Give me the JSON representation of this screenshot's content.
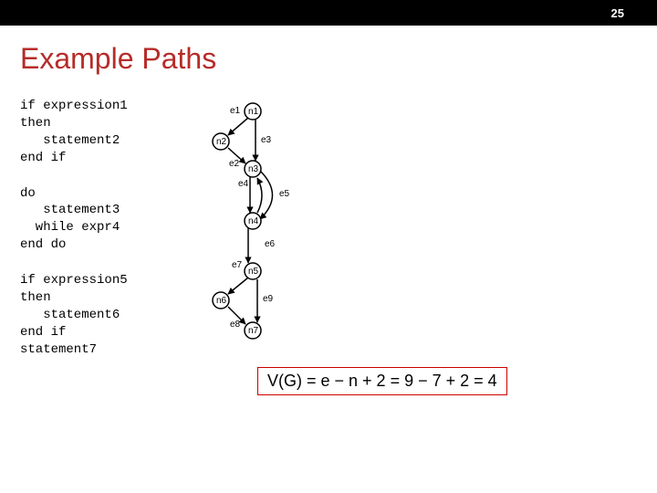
{
  "slide_number": "25",
  "title": "Example Paths",
  "code": {
    "block1": "if expression1\nthen\n   statement2\nend if",
    "block2": "do\n   statement3\n  while expr4\nend do",
    "block3": "if expression5\nthen\n   statement6\nend if\nstatement7"
  },
  "graph": {
    "nodes": {
      "n1": "n1",
      "n2": "n2",
      "n3": "n3",
      "n4": "n4",
      "n5": "n5",
      "n6": "n6",
      "n7": "n7"
    },
    "edges": {
      "e1": "e1",
      "e2": "e2",
      "e3": "e3",
      "e4": "e4",
      "e5": "e5",
      "e6": "e6",
      "e7": "e7",
      "e8": "e8",
      "e9": "e9"
    }
  },
  "formula": "V(G) = e − n + 2 = 9 − 7 + 2 = 4",
  "chart_data": {
    "type": "diagram",
    "description": "Control-flow graph with 7 nodes and 9 edges, cyclomatic complexity V(G)=4",
    "nodes": [
      "n1",
      "n2",
      "n3",
      "n4",
      "n5",
      "n6",
      "n7"
    ],
    "edges": [
      {
        "id": "e1",
        "from": "n1",
        "to": "n2"
      },
      {
        "id": "e2",
        "from": "n2",
        "to": "n3"
      },
      {
        "id": "e3",
        "from": "n1",
        "to": "n3"
      },
      {
        "id": "e4",
        "from": "n3",
        "to": "n4"
      },
      {
        "id": "e5",
        "from": "n3",
        "to": "n4"
      },
      {
        "id": "e6",
        "from": "n4",
        "to": "n3"
      },
      {
        "id": "e7",
        "from": "n4",
        "to": "n5"
      },
      {
        "id": "e8",
        "from": "n5",
        "to": "n7"
      },
      {
        "id": "e9",
        "from": "n6",
        "to": "n7"
      }
    ],
    "V_G": 4,
    "e": 9,
    "n": 7
  }
}
